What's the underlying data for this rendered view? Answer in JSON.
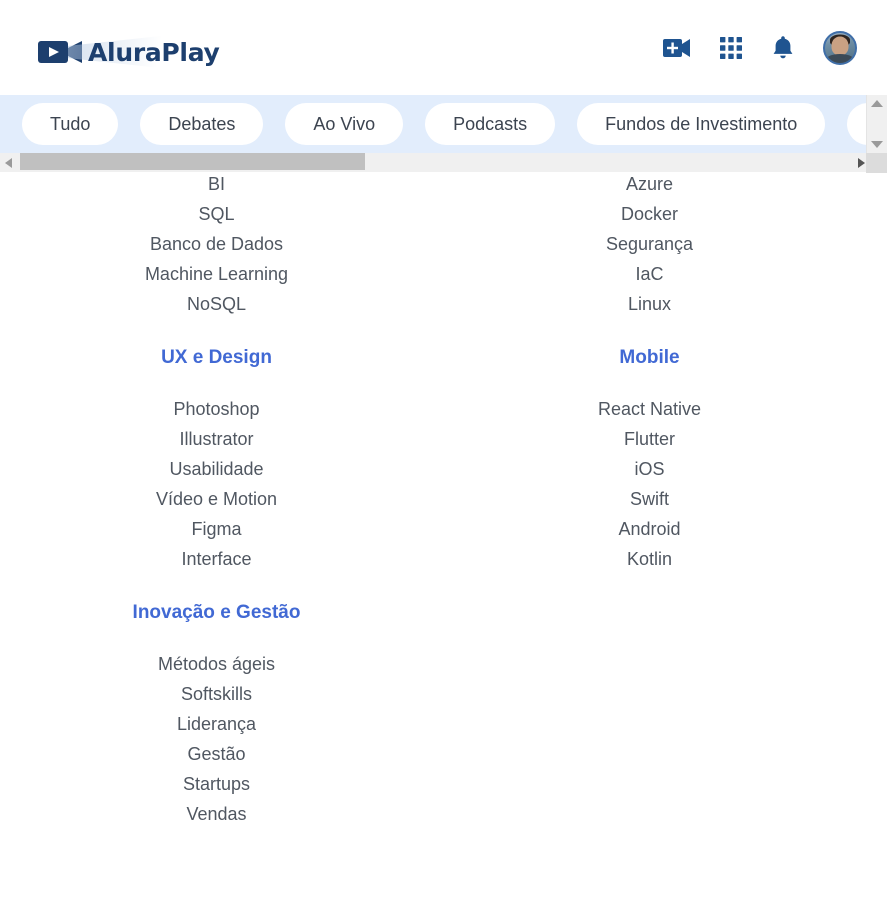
{
  "header": {
    "brand_name": "AluraPlay",
    "icons": [
      {
        "name": "video-add-icon",
        "label": "Criar vídeo"
      },
      {
        "name": "apps-grid-icon",
        "label": "Aplicativos"
      },
      {
        "name": "bell-icon",
        "label": "Notificações"
      },
      {
        "name": "avatar",
        "label": "Perfil"
      }
    ]
  },
  "tabs": [
    {
      "label": "Tudo"
    },
    {
      "label": "Debates"
    },
    {
      "label": "Ao Vivo"
    },
    {
      "label": "Podcasts"
    },
    {
      "label": "Fundos de Investimento"
    },
    {
      "label": ""
    }
  ],
  "scrollbars": {
    "horizontal": {
      "left_arrow": "◀",
      "right_arrow": "▶"
    },
    "vertical": {
      "up_arrow": "▲",
      "down_arrow": "▼"
    }
  },
  "menu": {
    "left_column": [
      {
        "title": "",
        "items": [
          "BI",
          "SQL",
          "Banco de Dados",
          "Machine Learning",
          "NoSQL"
        ]
      },
      {
        "title": "UX e Design",
        "items": [
          "Photoshop",
          "Illustrator",
          "Usabilidade",
          "Vídeo e Motion",
          "Figma",
          "Interface"
        ]
      },
      {
        "title": "Inovação e Gestão",
        "items": [
          "Métodos ágeis",
          "Softskills",
          "Liderança",
          "Gestão",
          "Startups",
          "Vendas"
        ]
      }
    ],
    "right_column": [
      {
        "title": "",
        "items": [
          "Azure",
          "Docker",
          "Segurança",
          "IaC",
          "Linux"
        ]
      },
      {
        "title": "Mobile",
        "items": [
          "React Native",
          "Flutter",
          "iOS",
          "Swift",
          "Android",
          "Kotlin"
        ]
      }
    ]
  },
  "colors": {
    "brand_navy": "#1d3f6e",
    "tabstrip_bg": "#e2edfc",
    "heading_blue": "#4169d4",
    "item_gray": "#505761",
    "icon_blue": "#1f5490"
  }
}
